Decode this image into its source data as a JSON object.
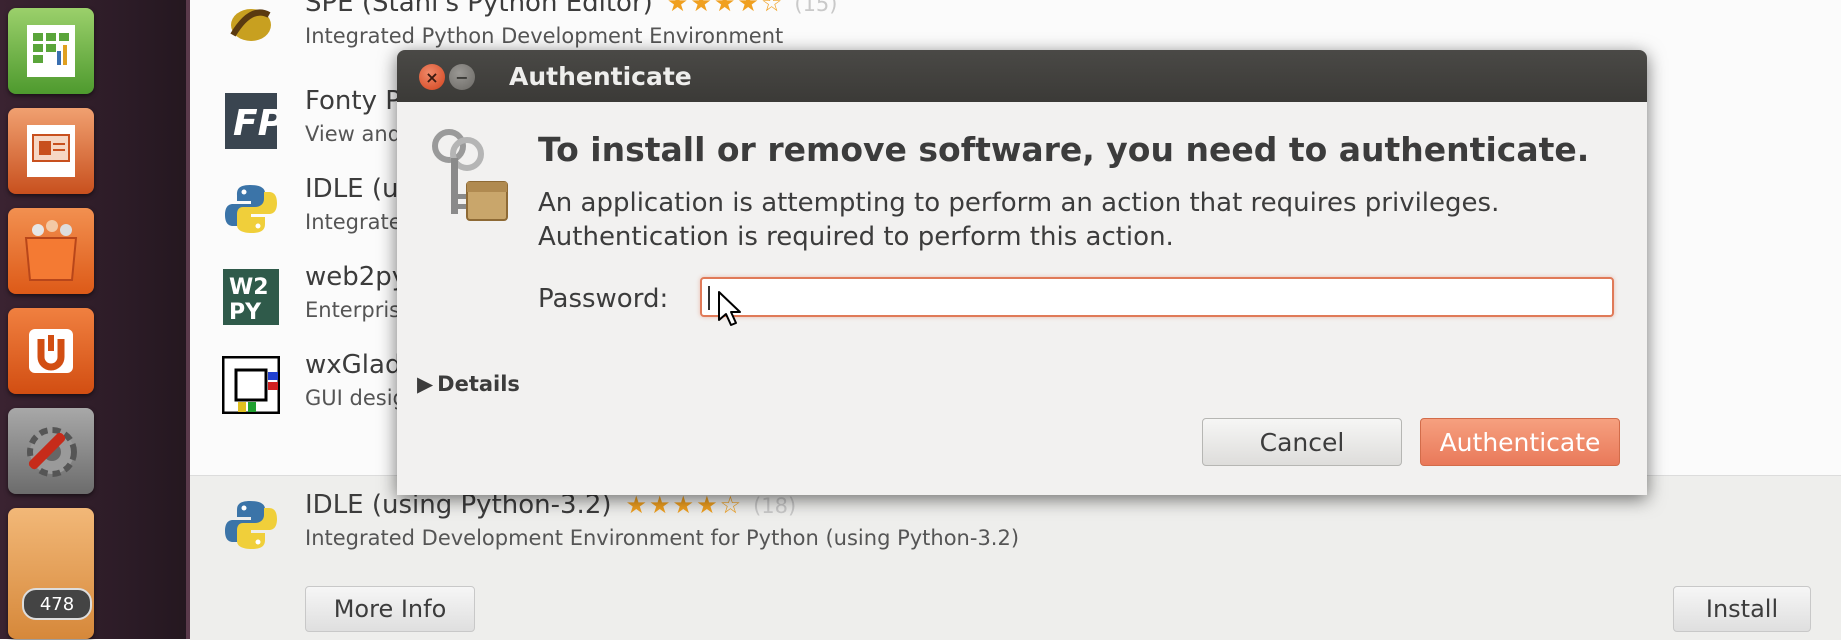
{
  "dialog": {
    "title": "Authenticate",
    "heading": "To install or remove software, you need to authenticate.",
    "message_line1": "An application is attempting to perform an action that requires privileges.",
    "message_line2": "Authentication is required to perform this action.",
    "password_label": "Password:",
    "password_value": "",
    "details_label": "Details",
    "cancel_label": "Cancel",
    "authenticate_label": "Authenticate",
    "icon": "keys-icon"
  },
  "launcher": {
    "items": [
      {
        "icon": "libreoffice-calc-icon"
      },
      {
        "icon": "libreoffice-impress-icon"
      },
      {
        "icon": "software-center-icon"
      },
      {
        "icon": "ubuntu-one-icon"
      },
      {
        "icon": "system-settings-icon"
      },
      {
        "icon": "update-manager-icon"
      }
    ],
    "badge_count": "478"
  },
  "software_list": {
    "rows": [
      {
        "name": "SPE (Stani's Python Editor)",
        "desc": "Integrated Python Development Environment",
        "rating": 4,
        "count": "(15)",
        "icon": "spe-icon"
      },
      {
        "name": "Fonty P",
        "desc": "View and",
        "icon": "fontypython-icon"
      },
      {
        "name": "IDLE (us",
        "desc": "Integrate",
        "icon": "python-icon"
      },
      {
        "name": "web2py",
        "desc": "Enterpris",
        "icon": "web2py-icon"
      },
      {
        "name": "wxGlad",
        "desc": "GUI desig",
        "icon": "wxglade-icon"
      }
    ],
    "selected": {
      "name": "IDLE (using Python-3.2)",
      "desc": "Integrated Development Environment for Python (using Python-3.2)",
      "rating": 4.5,
      "count": "(18)",
      "icon": "python-icon",
      "more_info_label": "More Info",
      "install_label": "Install"
    }
  },
  "colors": {
    "accent": "#e9795a",
    "titlebar": "#3c3b37",
    "launcher": "#2c1e28",
    "star": "#f0a020"
  }
}
